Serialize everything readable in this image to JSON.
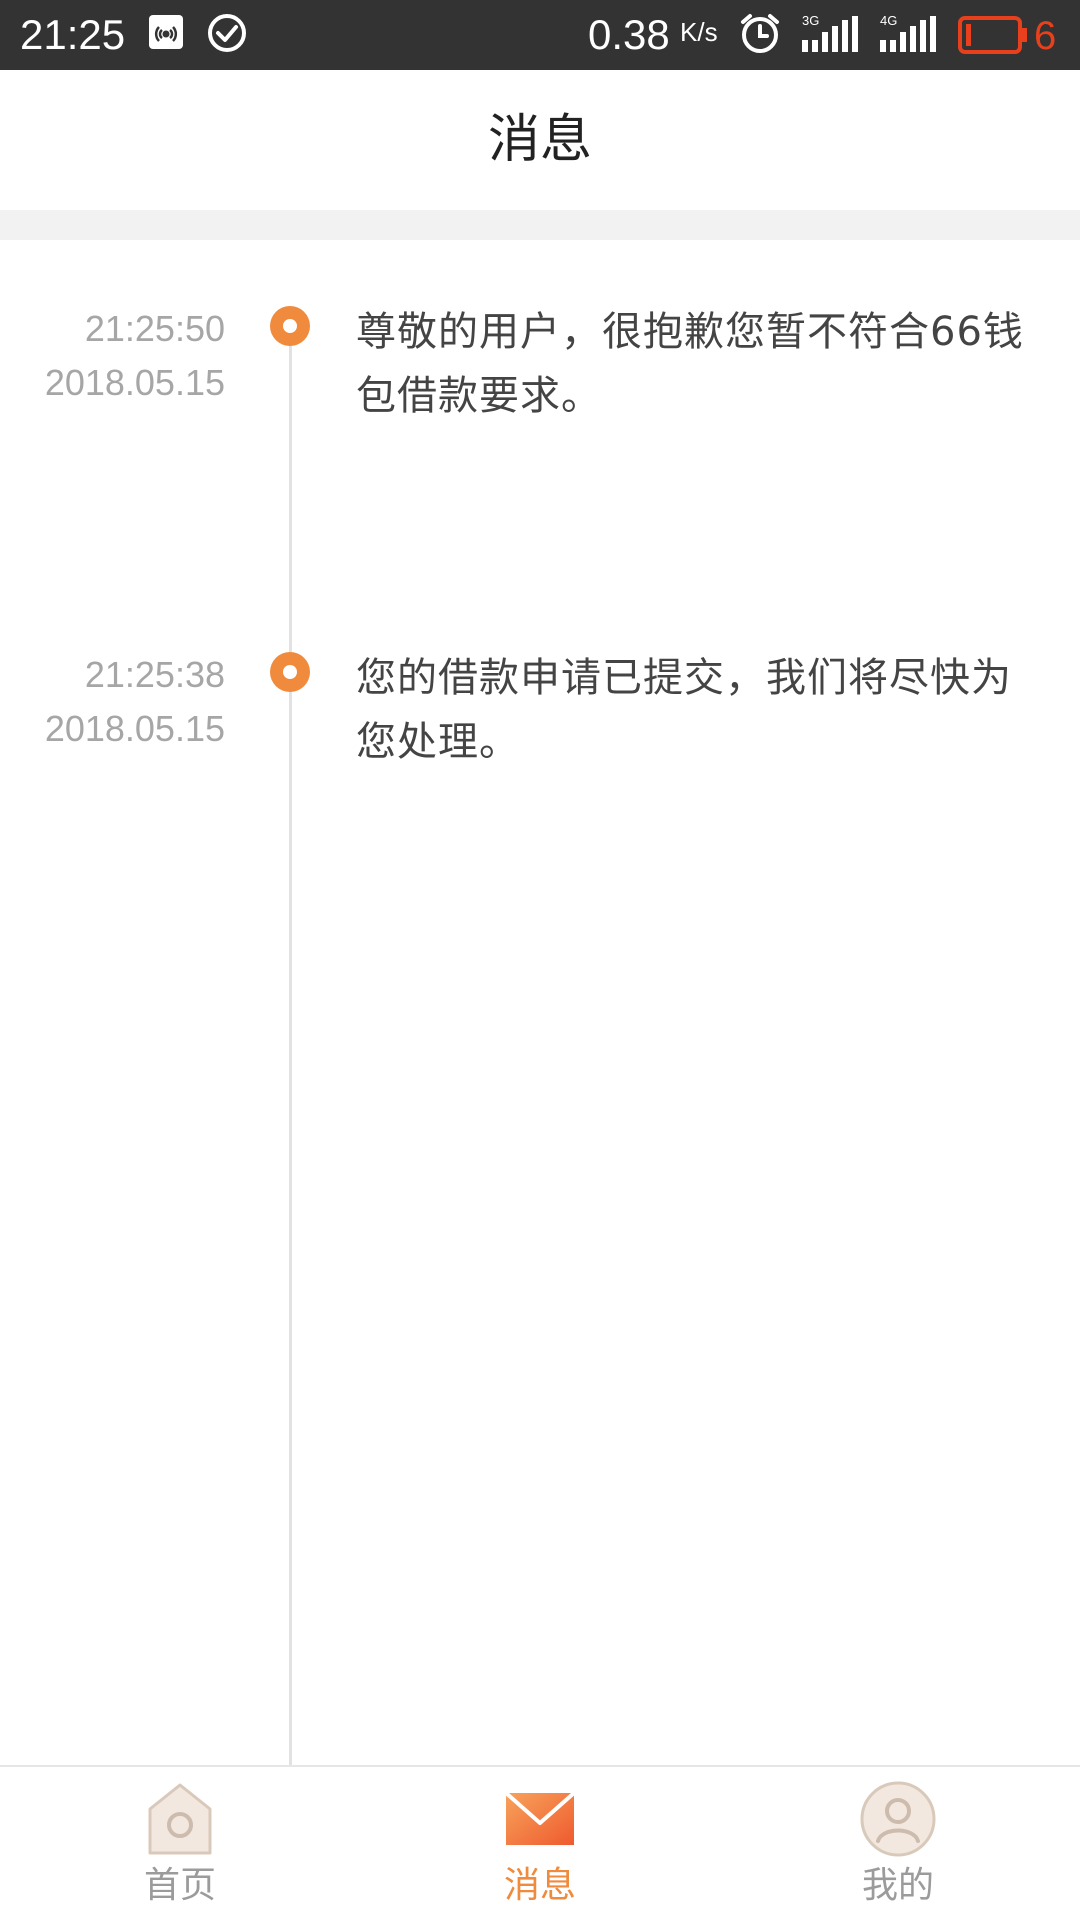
{
  "status_bar": {
    "time": "21:25",
    "net_speed": "0.38",
    "net_speed_unit": "K/s",
    "net1_label": "3G",
    "net2_label": "4G",
    "battery_level": "6",
    "icons": [
      "hotspot-icon",
      "check-circle-icon",
      "alarm-icon",
      "signal-3g-icon",
      "signal-4g-icon",
      "battery-icon"
    ],
    "battery_color": "#e8401c"
  },
  "header": {
    "title": "消息"
  },
  "messages": [
    {
      "time": "21:25:50",
      "date": "2018.05.15",
      "text": "尊敬的用户，很抱歉您暂不符合66钱包借款要求。"
    },
    {
      "time": "21:25:38",
      "date": "2018.05.15",
      "text": "您的借款申请已提交，我们将尽快为您处理。"
    }
  ],
  "bottom_nav": {
    "items": [
      {
        "label": "首页",
        "icon": "home-icon",
        "active": false
      },
      {
        "label": "消息",
        "icon": "mail-icon",
        "active": true
      },
      {
        "label": "我的",
        "icon": "profile-icon",
        "active": false
      }
    ]
  },
  "colors": {
    "accent": "#f08a3c",
    "status_bar_bg": "#333333",
    "timeline_line": "#e2e2e2",
    "inactive_nav": "#9b9b9b"
  }
}
